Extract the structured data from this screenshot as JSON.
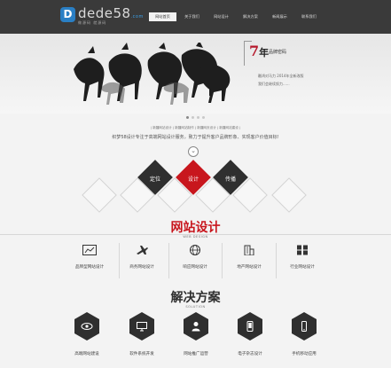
{
  "header": {
    "logo_mark": "D",
    "logo_name": "dede58",
    "logo_domain": ".com",
    "logo_sub": "做源码  就源码",
    "nav": [
      "网站首页",
      "关于我们",
      "网站设计",
      "解决方案",
      "新闻展示",
      "联系我们"
    ]
  },
  "banner": {
    "years": "7",
    "years_unit": "年",
    "brand": "品牌密码",
    "line1": "雕鸿对马力 2014年全新改版",
    "line2": "我们会继续努力......",
    "dots": 4
  },
  "intro": {
    "links": "| 新疆网站设计 | 新疆网站制作 | 新疆网页设计 | 新疆网站建设 |",
    "text": "织梦58设计专注于高端网站设计服务，致力于提升客户品牌形象、实现客户价值目标!"
  },
  "diamonds": [
    "定位",
    "设计",
    "传播"
  ],
  "web_design": {
    "title": "网站设计",
    "subtitle": "WEB DESIGN",
    "items": [
      {
        "label": "品牌型网站设计",
        "icon": "chart-icon"
      },
      {
        "label": "商务网站设计",
        "icon": "plane-icon"
      },
      {
        "label": "响应网站设计",
        "icon": "globe-icon"
      },
      {
        "label": "地产网站设计",
        "icon": "building-icon"
      },
      {
        "label": "行业网站设计",
        "icon": "grid-icon"
      }
    ]
  },
  "solution": {
    "title": "解决方案",
    "subtitle": "SOLUTION",
    "items": [
      {
        "label": "高端网站建设",
        "icon": "eye-icon"
      },
      {
        "label": "软件系统开发",
        "icon": "monitor-icon"
      },
      {
        "label": "网站推广运营",
        "icon": "user-icon"
      },
      {
        "label": "电子杂志设计",
        "icon": "tablet-icon"
      },
      {
        "label": "手机移动应用",
        "icon": "phone-icon"
      }
    ]
  },
  "colors": {
    "brand_red": "#c8161d",
    "dark": "#2f2f2f",
    "header": "#3a3a3a",
    "logo_blue": "#2a7fc4"
  }
}
